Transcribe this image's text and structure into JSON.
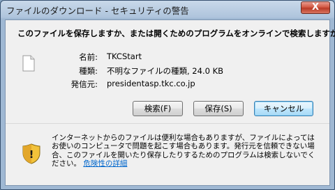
{
  "window": {
    "title": "ファイルのダウンロード - セキュリティの警告",
    "close_label": "X"
  },
  "question": "このファイルを保存しますか、または開くためのプログラムをオンラインで検索しますか?",
  "file": {
    "name_label": "名前:",
    "name_value": "TKCStart",
    "type_label": "種類:",
    "type_value": "不明なファイルの種類, 24.0 KB",
    "from_label": "発信元:",
    "from_value": "presidentasp.tkc.co.jp",
    "icon": "blank-file-icon"
  },
  "buttons": {
    "search": "検索(F)",
    "save": "保存(S)",
    "cancel": "キャンセル"
  },
  "warning": {
    "icon": "security-shield-icon",
    "text": "インターネットからのファイルは便利な場合もありますが、ファイルによってはお使いのコンピュータで問題を起こす場合もあります。発行元を信頼できない場合、このファイルを開いたり保存したりするためのプログラムは検索しないでください。",
    "link": "危険性の詳細"
  },
  "colors": {
    "title_bar": "#aec4dc",
    "dialog_bg": "#f0f0f0",
    "link": "#0066cc",
    "close_button": "#c84a34"
  }
}
